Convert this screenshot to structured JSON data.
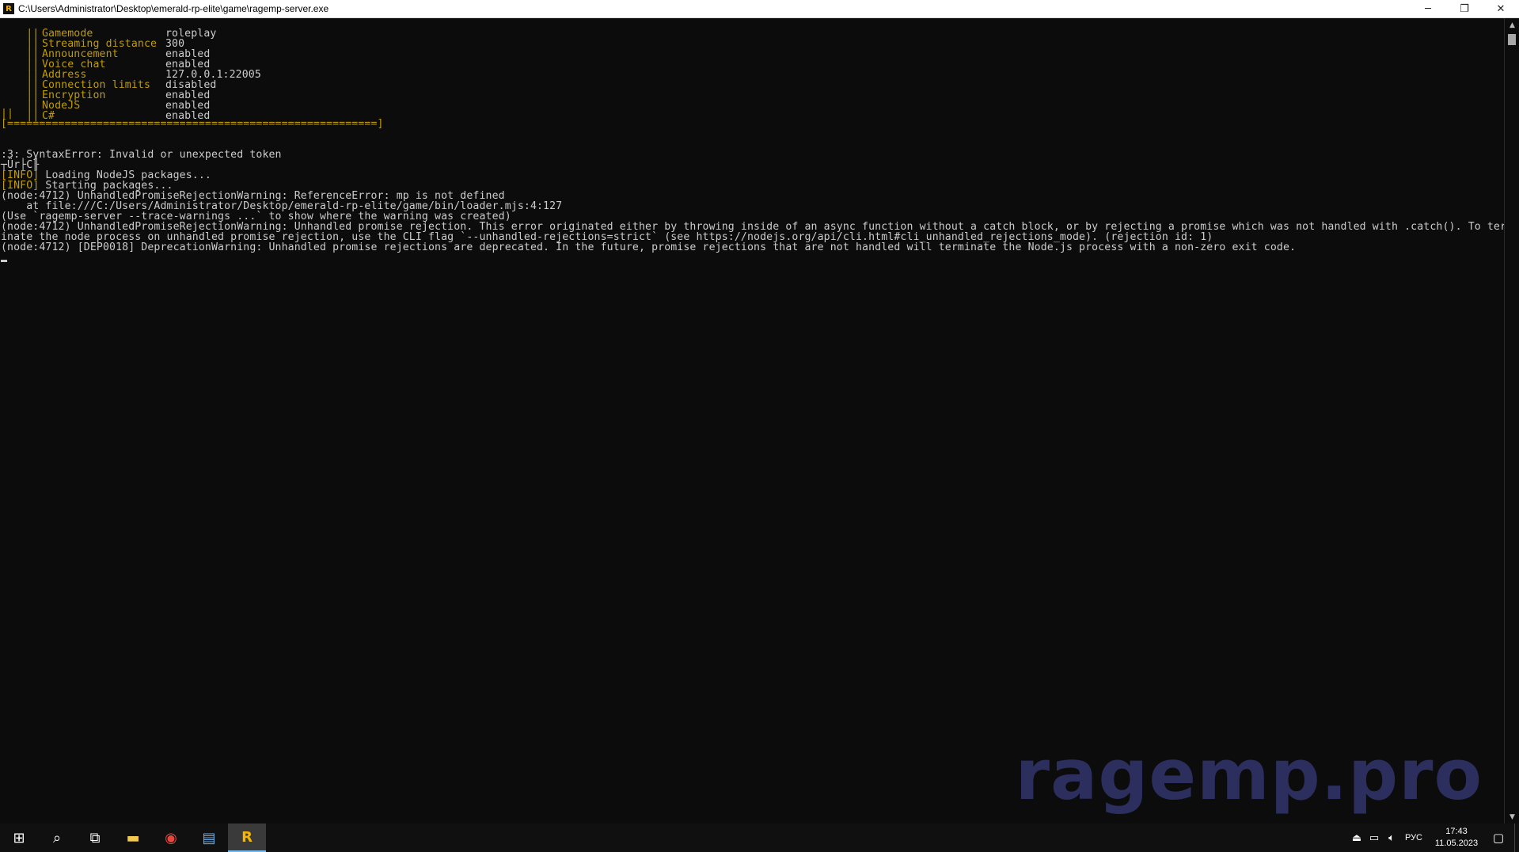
{
  "window": {
    "title": "C:\\Users\\Administrator\\Desktop\\emerald-rp-elite\\game\\ragemp-server.exe",
    "minimize": "─",
    "restore": "❐",
    "close": "✕"
  },
  "config_rows": [
    {
      "prefix": "||",
      "key": "Gamemode",
      "value": "roleplay"
    },
    {
      "prefix": "||",
      "key": "Streaming distance",
      "value": "300"
    },
    {
      "prefix": "||",
      "key": "Announcement",
      "value": "enabled"
    },
    {
      "prefix": "||",
      "key": "Voice chat",
      "value": "enabled"
    },
    {
      "prefix": "||",
      "key": "Address",
      "value": "127.0.0.1:22005"
    },
    {
      "prefix": "||",
      "key": "Connection limits",
      "value": "disabled"
    },
    {
      "prefix": "||",
      "key": "Encryption",
      "value": "enabled"
    },
    {
      "prefix": "||",
      "key": "NodeJS",
      "value": "enabled"
    },
    {
      "prefix": "||",
      "key": "C#",
      "value": "enabled"
    }
  ],
  "config_trailer": "||",
  "config_border": "[==========================================================]",
  "log": {
    "syntax_error": ":3: SyntaxError: Invalid or unexpected token",
    "garbled": "┬Ür├C╟",
    "info_tag": "[INFO]",
    "info_loading": " Loading NodeJS packages...",
    "info_starting": " Starting packages...",
    "ref_error": "(node:4712) UnhandledPromiseRejectionWarning: ReferenceError: mp is not defined",
    "ref_error_at": "    at file:///C:/Users/Administrator/Desktop/emerald-rp-elite/game/bin/loader.mjs:4:127",
    "trace_hint": "(Use `ragemp-server --trace-warnings ...` to show where the warning was created)",
    "unhandled_1": "(node:4712) UnhandledPromiseRejectionWarning: Unhandled promise rejection. This error originated either by throwing inside of an async function without a catch block, or by rejecting a promise which was not handled with .catch(). To term",
    "unhandled_2": "inate the node process on unhandled promise rejection, use the CLI flag `--unhandled-rejections=strict` (see https://nodejs.org/api/cli.html#cli_unhandled_rejections_mode). (rejection id: 1)",
    "deprecation": "(node:4712) [DEP0018] DeprecationWarning: Unhandled promise rejections are deprecated. In the future, promise rejections that are not handled will terminate the Node.js process with a non-zero exit code."
  },
  "watermark": "ragemp.pro",
  "taskbar": {
    "items": [
      {
        "name": "start-button",
        "glyph": "⊞"
      },
      {
        "name": "search-button",
        "glyph": "⌕"
      },
      {
        "name": "task-view-button",
        "glyph": "⧉"
      },
      {
        "name": "file-explorer-icon",
        "glyph": "▬"
      },
      {
        "name": "chrome-icon",
        "glyph": "◉"
      },
      {
        "name": "server-manager-icon",
        "glyph": "▤"
      },
      {
        "name": "ragemp-icon",
        "glyph": "R"
      }
    ],
    "lang": "РУС",
    "time": "17:43",
    "date": "11.05.2023"
  },
  "colors": {
    "console_bg": "#0c0c0c",
    "console_text": "#cccccc",
    "accent_gold": "#c19c00",
    "watermark": "#2c2f5e"
  }
}
